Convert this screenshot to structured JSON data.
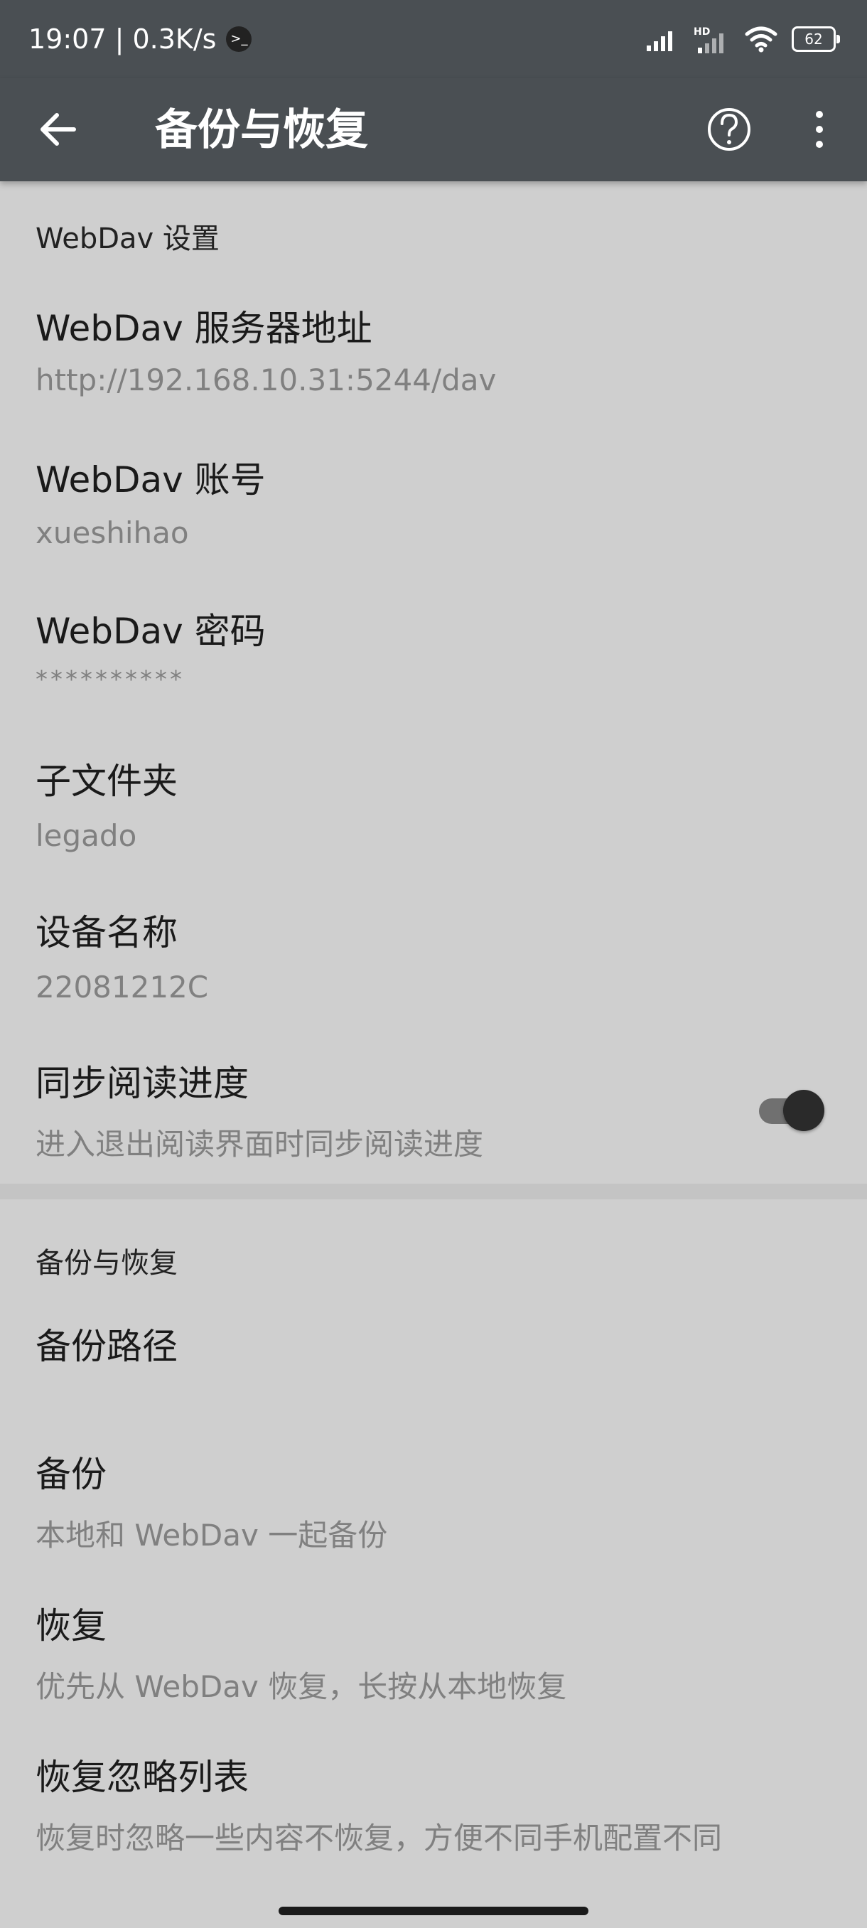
{
  "status_bar": {
    "time_speed": "19:07 | 0.3K/s",
    "term_glyph": ">_",
    "battery": "62",
    "hd_label": "HD"
  },
  "app_bar": {
    "title": "备份与恢复"
  },
  "webdav_section": {
    "header": "WebDav 设置",
    "server_title": "WebDav 服务器地址",
    "server_value": "http://192.168.10.31:5244/dav",
    "account_title": "WebDav 账号",
    "account_value": "xueshihao",
    "password_title": "WebDav 密码",
    "password_value": "**********",
    "subfolder_title": "子文件夹",
    "subfolder_value": "legado",
    "device_title": "设备名称",
    "device_value": "22081212C",
    "sync_title": "同步阅读进度",
    "sync_summary": "进入退出阅读界面时同步阅读进度",
    "sync_enabled": true
  },
  "backup_section": {
    "header": "备份与恢复",
    "path_title": "备份路径",
    "backup_title": "备份",
    "backup_summary": "本地和 WebDav 一起备份",
    "restore_title": "恢复",
    "restore_summary": "优先从 WebDav 恢复，长按从本地恢复",
    "ignore_title": "恢复忽略列表",
    "ignore_summary": "恢复时忽略一些内容不恢复，方便不同手机配置不同"
  },
  "icons": {
    "back": "arrow-back-icon",
    "help": "help-circle-icon",
    "more": "more-vert-icon",
    "signal": "signal-icon",
    "wifi": "wifi-icon",
    "battery": "battery-icon"
  },
  "colors": {
    "app_bar": "#4a4f53",
    "background": "#cfcfcf",
    "summary_text": "#808080"
  }
}
